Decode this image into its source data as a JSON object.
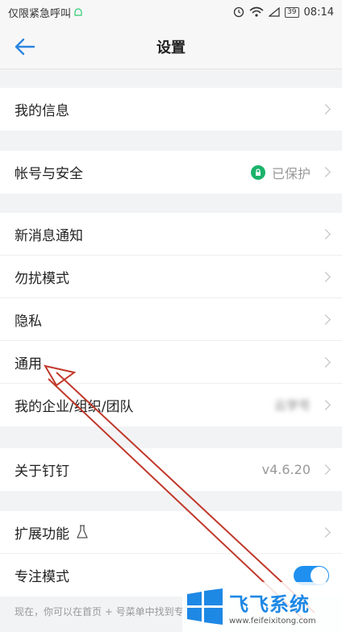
{
  "status_bar": {
    "left_text": "仅限紧急呼叫",
    "battery": "39",
    "time": "08:14"
  },
  "header": {
    "title": "设置"
  },
  "groups": [
    {
      "items": [
        {
          "label": "我的信息"
        }
      ]
    },
    {
      "items": [
        {
          "label": "帐号与安全",
          "value": "已保护"
        }
      ]
    },
    {
      "items": [
        {
          "label": "新消息通知"
        },
        {
          "label": "勿扰模式"
        },
        {
          "label": "隐私"
        },
        {
          "label": "通用"
        },
        {
          "label": "我的企业/组织/团队",
          "value": "云学号"
        }
      ]
    },
    {
      "items": [
        {
          "label": "关于钉钉",
          "value": "v4.6.20"
        }
      ]
    },
    {
      "items": [
        {
          "label": "扩展功能"
        },
        {
          "label": "专注模式",
          "toggle_on": true
        }
      ]
    }
  ],
  "footer_note": "现在，你可以在首页 + 号菜单中找到专注模式",
  "watermark": {
    "title": "飞飞系统",
    "url": "www.feifeixitong.com"
  },
  "colors": {
    "accent": "#1f90f0",
    "green": "#1bb36a",
    "arrow": "#c0392b"
  }
}
